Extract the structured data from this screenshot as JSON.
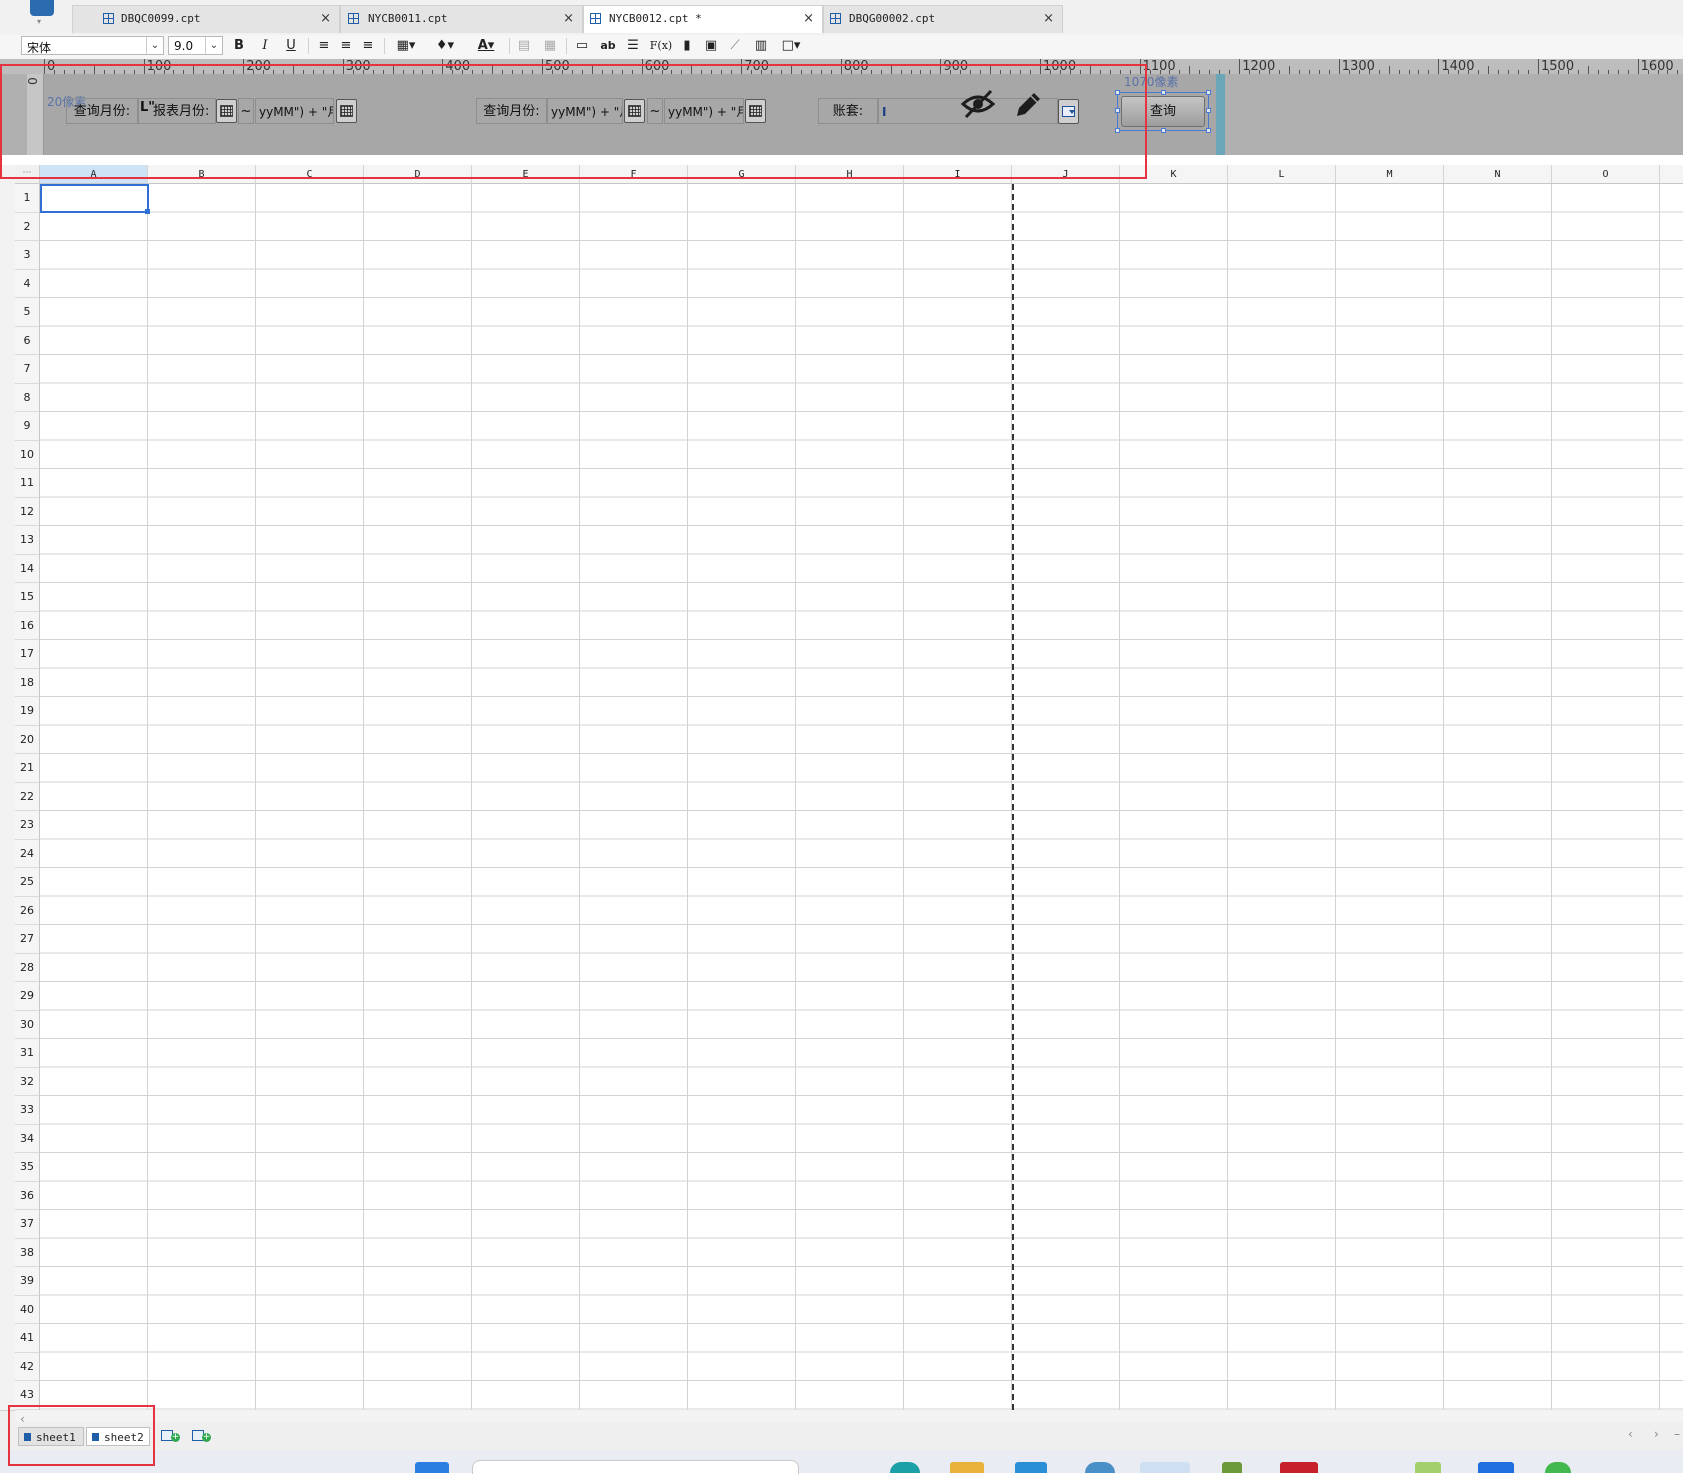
{
  "tabs": [
    {
      "label": "DBQC0099.cpt",
      "close": "×",
      "active": false
    },
    {
      "label": "NYCB0011.cpt",
      "close": "×",
      "active": false
    },
    {
      "label": "NYCB0012.cpt *",
      "close": "×",
      "active": true
    },
    {
      "label": "DBQG00002.cpt",
      "close": "×",
      "active": false
    }
  ],
  "toolbar": {
    "font_family": "宋体",
    "font_size": "9.0",
    "bold": "B",
    "italic": "I",
    "underline": "U",
    "text_tool": "ab",
    "formula": "F(x)",
    "combo_arrow": "⌄"
  },
  "ruler": {
    "labels": [
      "0",
      "100",
      "200",
      "300",
      "400",
      "500",
      "600",
      "700",
      "800",
      "900",
      "1000",
      "1100",
      "1200",
      "1300",
      "1400",
      "1500",
      "1600"
    ],
    "vertical_zero": "0"
  },
  "param_panel": {
    "hint_left": "20像素",
    "hint_right": "1070像素",
    "label_query_month_1": "查询月份:",
    "label_report_month": "报表月份:",
    "report_marker": "L\"",
    "field_1": "yyMM\") + \"月\"",
    "tilde_1": "~",
    "label_query_month_2": "查询月份:",
    "field_2": "yyMM\") + \"月\"",
    "tilde_2": "~",
    "field_3": "yyMM\") + \"月\"",
    "label_account": "账套:",
    "account_value": "I",
    "query_button": "查询"
  },
  "columns": [
    "A",
    "B",
    "C",
    "D",
    "E",
    "F",
    "G",
    "H",
    "I",
    "J",
    "K",
    "L",
    "M",
    "N",
    "O"
  ],
  "rows": [
    "1",
    "2",
    "3",
    "4",
    "5",
    "6",
    "7",
    "8",
    "9",
    "10",
    "11",
    "12",
    "13",
    "14",
    "15",
    "16",
    "17",
    "18",
    "19",
    "20",
    "21",
    "22",
    "23",
    "24",
    "25",
    "26",
    "27",
    "28",
    "29",
    "30",
    "31",
    "32",
    "33",
    "34",
    "35",
    "36",
    "37",
    "38",
    "39",
    "40",
    "41",
    "42",
    "43"
  ],
  "sheet_tabs": [
    {
      "label": "sheet1"
    },
    {
      "label": "sheet2"
    }
  ],
  "corner_glyph": "⋯",
  "scroll_left": "‹",
  "scroll_nav": [
    "‹",
    "›",
    "–"
  ],
  "colors": {
    "accent": "#2f6fd6",
    "highlight": "#e53340",
    "edge": "#6aa5b8"
  }
}
